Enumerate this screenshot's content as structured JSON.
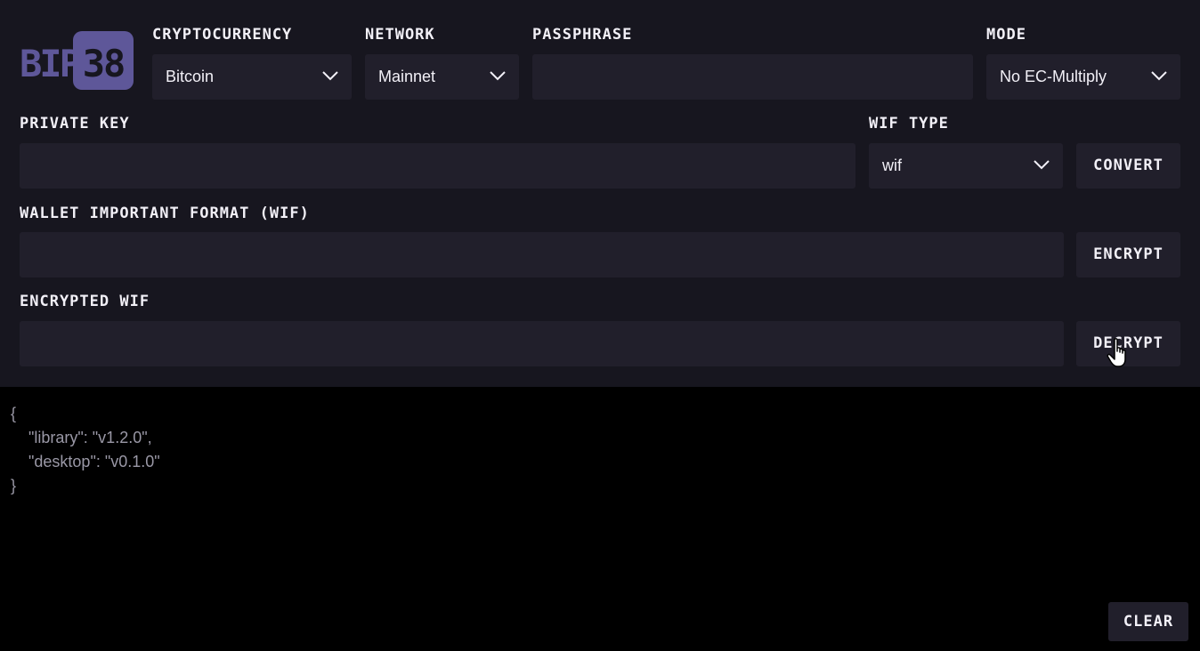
{
  "logo": {
    "left_text": "BIP",
    "badge_text": "38",
    "accent": "#5e5799"
  },
  "labels": {
    "cryptocurrency": "CRYPTOCURRENCY",
    "network": "NETWORK",
    "passphrase": "PASSPHRASE",
    "mode": "MODE",
    "private_key": "PRIVATE KEY",
    "wif_type": "WIF TYPE",
    "wif": "WALLET IMPORTANT FORMAT (WIF)",
    "encrypted_wif": "ENCRYPTED WIF"
  },
  "selects": {
    "cryptocurrency": "Bitcoin",
    "network": "Mainnet",
    "mode": "No EC-Multiply",
    "wif_type": "wif"
  },
  "inputs": {
    "passphrase": "",
    "private_key": "",
    "wif": "",
    "encrypted_wif": ""
  },
  "buttons": {
    "convert": "CONVERT",
    "encrypt": "ENCRYPT",
    "decrypt": "DECRYPT",
    "clear": "CLEAR"
  },
  "output": {
    "open": "{",
    "line1": "    \"library\": \"v1.2.0\",",
    "line2": "    \"desktop\": \"v0.1.0\"",
    "close": "}"
  },
  "colors": {
    "panel": "#17161f",
    "field": "#211f2b",
    "output_bg": "#000000",
    "text": "#f2f0f7",
    "output_text": "#9a98a6"
  }
}
